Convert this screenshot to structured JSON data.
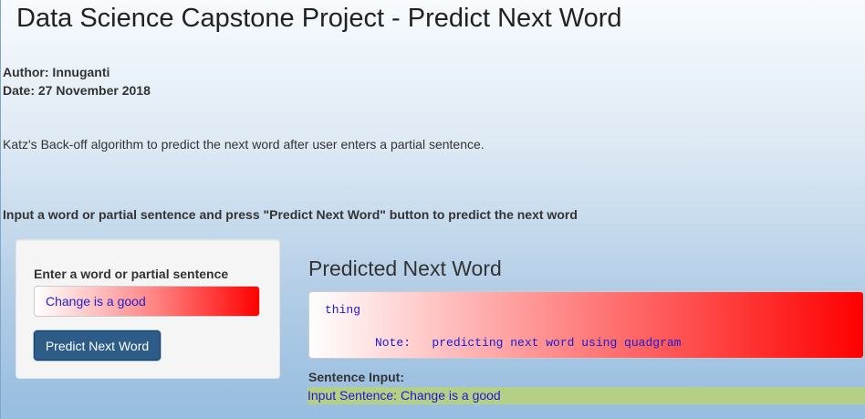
{
  "page": {
    "title": "Data Science Capstone Project - Predict Next Word",
    "author": "Author: Innuganti",
    "date": "Date: 27 November 2018",
    "description": "Katz's Back-off algorithm to predict the next word after user enters a partial sentence.",
    "instruction": "Input a word or partial sentence and press \"Predict Next Word\" button to predict the next word"
  },
  "sidebar": {
    "input_label": "Enter a word or partial sentence",
    "input_value": "Change is a good",
    "button_label": "Predict Next Word"
  },
  "main": {
    "heading": "Predicted Next Word",
    "predicted_word": "thing",
    "note_label": "Note:",
    "note_text": "predicting next word using quadgram",
    "sentence_label": "Sentence Input:",
    "sentence_text": "Input Sentence: Change is a good"
  }
}
